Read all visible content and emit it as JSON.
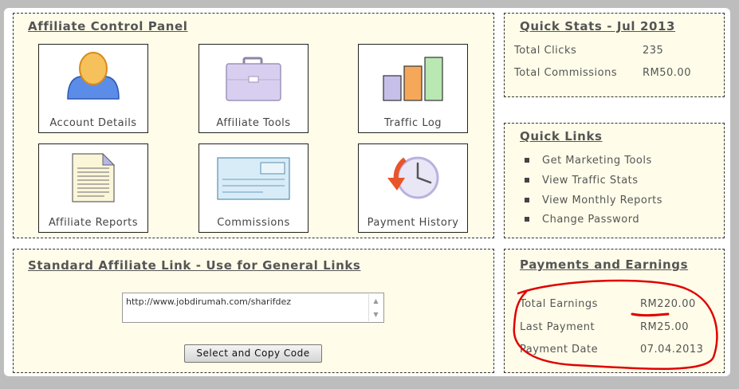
{
  "control_panel": {
    "title": "Affiliate Control Panel",
    "tiles": [
      {
        "label": "Account Details",
        "icon": "user-icon"
      },
      {
        "label": "Affiliate Tools",
        "icon": "briefcase-icon"
      },
      {
        "label": "Traffic Log",
        "icon": "bar-chart-icon"
      },
      {
        "label": "Affiliate Reports",
        "icon": "document-icon"
      },
      {
        "label": "Commissions",
        "icon": "cheque-icon"
      },
      {
        "label": "Payment History",
        "icon": "history-icon"
      }
    ]
  },
  "quick_stats": {
    "title": "Quick Stats - Jul 2013",
    "rows": [
      {
        "label": "Total Clicks",
        "value": "235"
      },
      {
        "label": "Total Commissions",
        "value": "RM50.00"
      }
    ]
  },
  "quick_links": {
    "title": "Quick Links",
    "items": [
      "Get Marketing Tools",
      "View Traffic Stats",
      "View Monthly Reports",
      "Change Password"
    ]
  },
  "affiliate_link": {
    "title": "Standard Affiliate Link - Use for General Links",
    "url": "http://www.jobdirumah.com/sharifdez",
    "button_label": "Select and Copy Code"
  },
  "payments": {
    "title": "Payments and Earnings",
    "rows": [
      {
        "label": "Total Earnings",
        "value": "RM220.00"
      },
      {
        "label": "Last Payment",
        "value": "RM25.00"
      },
      {
        "label": "Payment Date",
        "value": "07.04.2013"
      }
    ]
  },
  "colors": {
    "panel_bg": "#fffde9",
    "annotation": "#e00000"
  }
}
